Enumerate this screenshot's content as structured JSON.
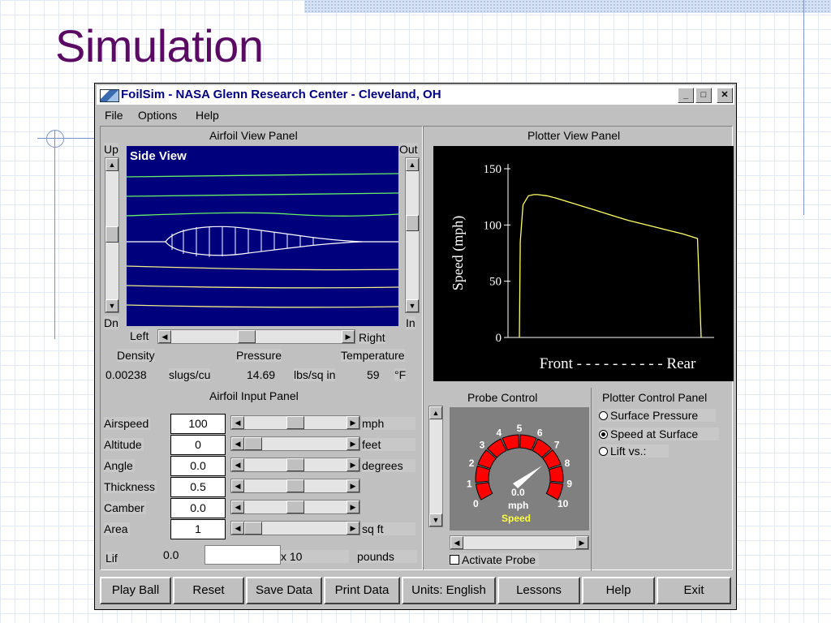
{
  "slide": {
    "title": "Simulation"
  },
  "window": {
    "title": "FoilSim - NASA Glenn Research Center - Cleveland, OH",
    "minimize": "_",
    "maximize": "□",
    "close": "✕"
  },
  "menu": [
    "File",
    "Options",
    "Help"
  ],
  "airfoil_view": {
    "panel_title": "Airfoil View Panel",
    "up": "Up",
    "dn": "Dn",
    "out": "Out",
    "in": "In",
    "view_label": "Side View",
    "left": "Left",
    "right": "Right"
  },
  "atmosphere": {
    "density_label": "Density",
    "density_value": "0.00238",
    "density_unit": "slugs/cu",
    "pressure_label": "Pressure",
    "pressure_value": "14.69",
    "pressure_unit": "lbs/sq in",
    "temperature_label": "Temperature",
    "temperature_value": "59",
    "temperature_unit": "°F"
  },
  "input_panel": {
    "title": "Airfoil Input Panel",
    "rows": [
      {
        "label": "Airspeed",
        "value": "100",
        "unit": "mph",
        "slider": 0.5
      },
      {
        "label": "Altitude",
        "value": "0",
        "unit": "feet",
        "slider": 0.0
      },
      {
        "label": "Angle",
        "value": "0.0",
        "unit": "degrees",
        "slider": 0.5
      },
      {
        "label": "Thickness",
        "value": "0.5",
        "unit": "",
        "slider": 0.5
      },
      {
        "label": "Camber",
        "value": "0.0",
        "unit": "",
        "slider": 0.5
      },
      {
        "label": "Area",
        "value": "1",
        "unit": "sq ft",
        "slider": 0.0
      }
    ],
    "lift_label": "Lif",
    "lift_value": "0.0",
    "lift_multiplier": "x 10",
    "lift_unit": "pounds"
  },
  "plotter_view": {
    "panel_title": "Plotter View Panel"
  },
  "chart_data": {
    "type": "line",
    "title": "",
    "ylabel": "Speed (mph)",
    "xlabel": "Front  - - - - - - - - - -  Rear",
    "ylim": [
      0,
      150
    ],
    "yticks": [
      "0",
      "50",
      "100",
      "150"
    ],
    "x": [
      0.0,
      0.005,
      0.02,
      0.05,
      0.08,
      0.1,
      0.15,
      0.2,
      0.3,
      0.4,
      0.5,
      0.6,
      0.7,
      0.8,
      0.9,
      0.98,
      1.0
    ],
    "series": [
      {
        "values": [
          0,
          85,
          118,
          126,
          127,
          127,
          126,
          124,
          119,
          114,
          109,
          104,
          100,
          96,
          92,
          88,
          0
        ],
        "color": "#ffff66"
      }
    ],
    "grid": false
  },
  "probe_control": {
    "title": "Probe Control",
    "dial_labels": [
      "0",
      "1",
      "2",
      "3",
      "4",
      "5",
      "6",
      "7",
      "8",
      "9",
      "10"
    ],
    "reading": "0.0",
    "unit": "mph",
    "mode": "Speed",
    "activate_label": "Activate Probe"
  },
  "plotter_control": {
    "title": "Plotter Control Panel",
    "options": [
      {
        "label": "Surface Pressure",
        "selected": false
      },
      {
        "label": "Speed at Surface",
        "selected": true
      },
      {
        "label": "Lift vs.:",
        "selected": false
      }
    ]
  },
  "buttons": [
    "Play Ball",
    "Reset",
    "Save Data",
    "Print Data",
    "Units: English",
    "Lessons",
    "Help",
    "Exit"
  ]
}
